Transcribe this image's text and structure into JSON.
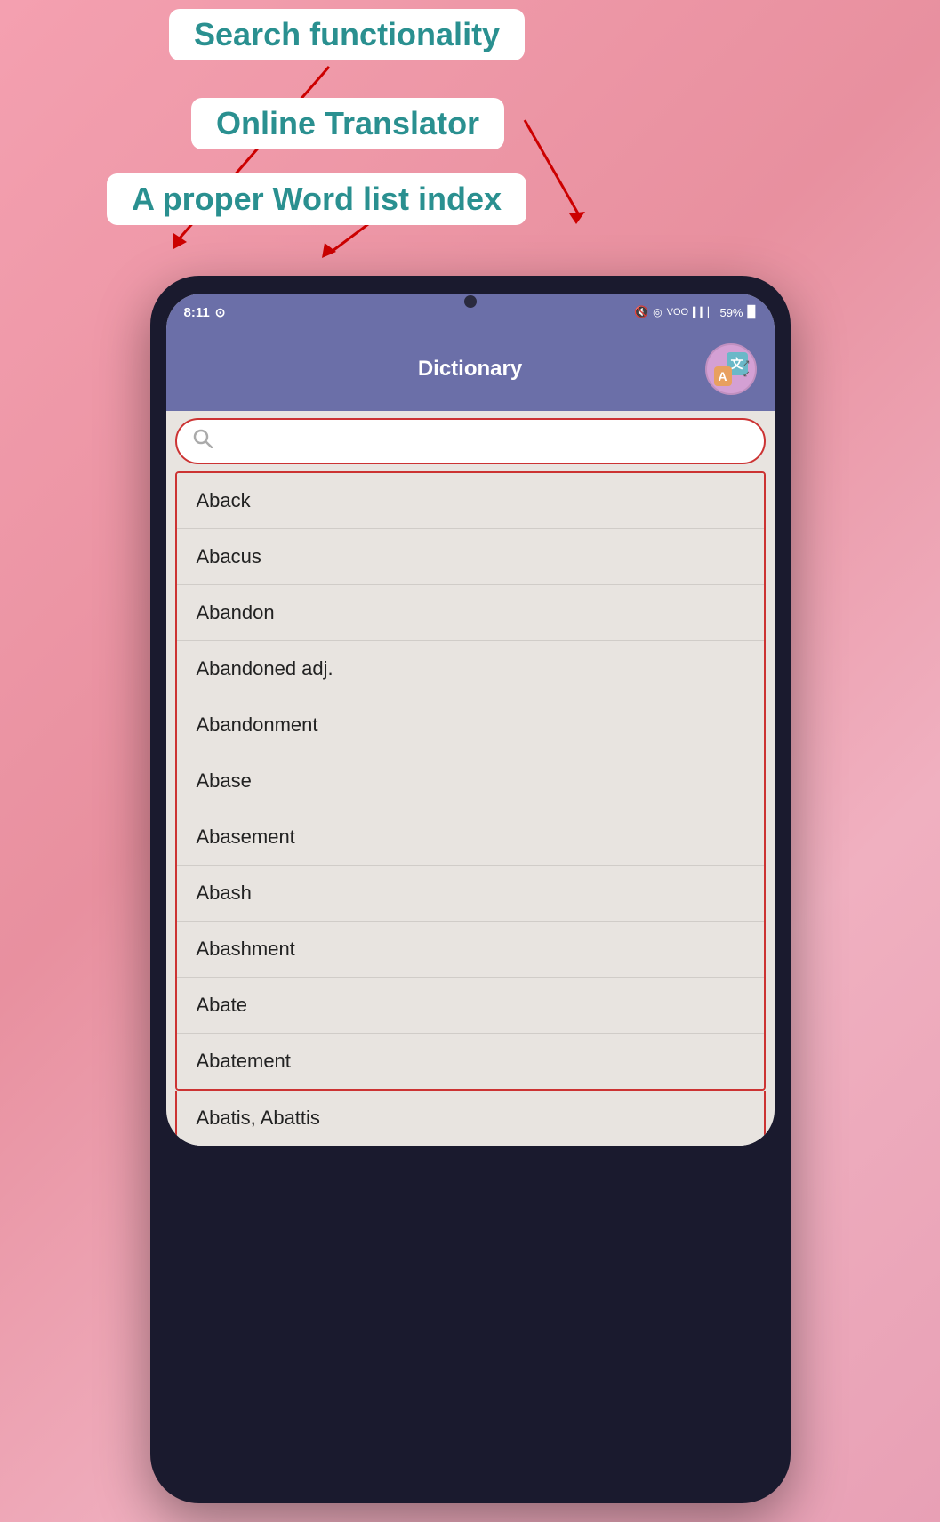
{
  "annotations": {
    "search_label": "Search functionality",
    "translator_label": "Online Translator",
    "wordlist_label": "A proper Word list index"
  },
  "status_bar": {
    "time": "8:11",
    "whatsapp_icon": "💬",
    "battery": "59%",
    "signal_icons": "🔇 ◎ VOO"
  },
  "header": {
    "title": "Dictionary",
    "translate_zh": "文",
    "translate_en": "A"
  },
  "search": {
    "placeholder": ""
  },
  "word_list": [
    "Aback",
    "Abacus",
    "Abandon",
    "Abandoned adj.",
    "Abandonment",
    "Abase",
    "Abasement",
    "Abash",
    "Abashment",
    "Abate",
    "Abatement"
  ],
  "partial_word": "Abatis, Abattis",
  "colors": {
    "header_bg": "#6b6fa8",
    "annotation_text": "#2a9090",
    "search_border": "#cc3333",
    "list_border": "#cc3333",
    "arrow_color": "#cc0000"
  }
}
